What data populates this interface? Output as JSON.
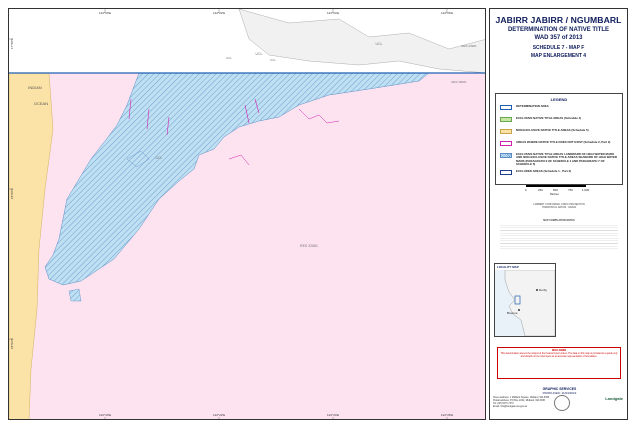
{
  "title": {
    "line1": "JABIRR JABIRR / NGUMBARL",
    "line2": "DETERMINATION OF NATIVE TITLE",
    "line3": "WAD 357 of 2013",
    "line4": "SCHEDULE 7 - MAP F",
    "line5": "MAP ENLARGEMENT 4"
  },
  "legend": {
    "heading": "LEGEND",
    "items": [
      {
        "label": "DETERMINATION AREA",
        "fill": "#ffffff",
        "border": "#1f5fb3",
        "style": "outline"
      },
      {
        "label": "EXCLUSIVE NATIVE TITLE AREAS (Schedule 4)",
        "fill": "#c6e6a3",
        "border": "#6aa84f",
        "style": "fill"
      },
      {
        "label": "NON-EXCLUSIVE NATIVE TITLE AREAS (Schedule 5)",
        "fill": "#fbe2a6",
        "border": "#c9a34a",
        "style": "fill"
      },
      {
        "label": "AREAS WHERE NATIVE TITLE DOES NOT EXIST (Schedule 2, Part 2)",
        "fill": "#ffffff",
        "border": "#d21fb3",
        "style": "outline"
      },
      {
        "label": "EXCLUSIVE NATIVE TITLE AREAS LANDWARD OF HIGH WATER MARK AND NON-EXCLUSIVE NATIVE TITLE AREAS SEAWARD OF HIGH WATER MARK (PARAGRAPH 9 OF SCHEDULE 4 AND PARAGRAPH 7 OF SCHEDULE 5)",
        "fill": "#bfe0f2",
        "border": "#5b8ec7",
        "style": "hatch"
      },
      {
        "label": "EXCLUDED AREAS (Schedule 1 , Part 2)",
        "fill": "#ffffff",
        "border": "#1f3f8f",
        "style": "outline"
      }
    ]
  },
  "scale": {
    "ticks": [
      "0",
      "250",
      "500",
      "750",
      "1,000"
    ],
    "unit": "Metres"
  },
  "notes": {
    "projection": "LAMBERT CONFORMAL CONIC PROJECTION",
    "datum": "HORIZONTAL DATUM : GDA94",
    "compiled_heading": "MAP COMPILATION NOTES"
  },
  "locality": {
    "title": "LOCALITY MAP",
    "towns": [
      "Derby",
      "Broome"
    ]
  },
  "warning": {
    "heading": "DISCLAIMER",
    "text": "This determination area is the subject of the Federal Court orders. The data on this map is provided as a guide only and should not be relied upon as an accurate representation of boundaries."
  },
  "services": {
    "line1": "GRAPHIC SERVICES",
    "line2": "PRODUCED: 11/04/2019"
  },
  "contact": {
    "line1": "Street address: 1 Midland Square, Midland, WA 6056",
    "line2": "Postal address: PO Box 2222, Midland, WA 6936",
    "line3": "Tel: (08) 9273 7373",
    "line4": "Email: info@landgate.wa.gov.au"
  },
  "brand": {
    "agency": "Landgate"
  },
  "map": {
    "coords_top": [
      "122°20'E",
      "122°22'E",
      "122°24'E",
      "122°26'E"
    ],
    "coords_bottom": [
      "122°20'E",
      "122°22'E",
      "122°24'E",
      "122°26'E"
    ],
    "coords_left": [
      "17°58'S",
      "18°00'S",
      "18°02'S"
    ],
    "labels": {
      "indian": "INDIAN",
      "ocean": "OCEAN",
      "ucl1": "UCL",
      "ucl2": "UCL",
      "ucl3": "UCL",
      "res": "RES 22681",
      "res2": "RES 23981",
      "resv": "RES 38001",
      "l1": "UCL",
      "l2": "UCL"
    },
    "colors": {
      "pink": "#fde3ef",
      "peach": "#fbe2a6",
      "hatch": "#bfe0f2",
      "boundary": "#1f5fb3",
      "magenta": "#d21fb3"
    }
  }
}
